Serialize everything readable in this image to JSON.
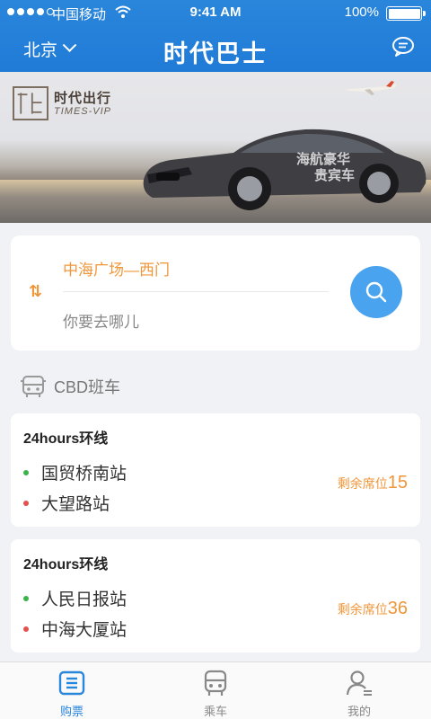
{
  "status_bar": {
    "carrier": "中国移动",
    "time": "9:41 AM",
    "battery": "100%",
    "icons": [
      "signal-dots-icon",
      "wifi-icon",
      "battery-icon"
    ]
  },
  "header": {
    "city": "北京",
    "title": "时代巴士",
    "message_icon": "chat-bubble-icon"
  },
  "banner": {
    "logo_text": "时代出行",
    "logo_sub": "TIMES-VIP",
    "image": "luxury-car-and-airplane-banner"
  },
  "search": {
    "from": "中海广场—西门",
    "to_placeholder": "你要去哪儿",
    "swap_icon": "swap-arrows-icon",
    "search_icon": "search-icon"
  },
  "section": {
    "label": "CBD班车",
    "icon": "bus-icon"
  },
  "routes": [
    {
      "name": "24hours环线",
      "start_stop": "国贸桥南站",
      "end_stop": "大望路站",
      "seat_label": "剩余席位",
      "seats": "15"
    },
    {
      "name": "24hours环线",
      "start_stop": "人民日报站",
      "end_stop": "中海大厦站",
      "seat_label": "剩余席位",
      "seats": "36"
    }
  ],
  "tabs": [
    {
      "label": "购票",
      "icon": "ticket-icon",
      "active": true
    },
    {
      "label": "乘车",
      "icon": "bus-front-icon",
      "active": false
    },
    {
      "label": "我的",
      "icon": "profile-icon",
      "active": false
    }
  ],
  "colors": {
    "primary": "#2a86db",
    "accent_orange": "#f0963a",
    "start_dot": "#3cb34a",
    "end_dot": "#e0524b",
    "search_button": "#4aa3ee"
  }
}
